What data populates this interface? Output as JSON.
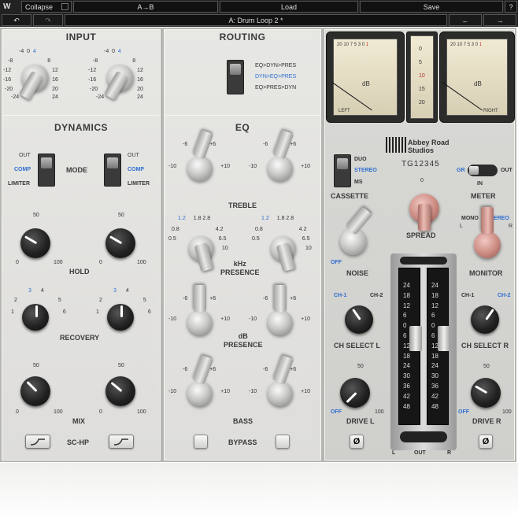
{
  "topbar": {
    "collapse": "Collapse",
    "ab": "A→B",
    "load": "Load",
    "save": "Save",
    "help": "?",
    "preset": "A: Drum Loop 2 *",
    "undo": "↶",
    "redo": "↷",
    "prev": "←",
    "next": "→"
  },
  "input": {
    "title": "INPUT",
    "scale": [
      "-4",
      "0",
      "4",
      "-8",
      "8",
      "-12",
      "12",
      "-16",
      "16",
      "-20",
      "20",
      "-24",
      "24"
    ]
  },
  "dynamics": {
    "title": "DYNAMICS",
    "mode": "MODE",
    "out": "OUT",
    "comp": "COMP",
    "limiter": "LIMITER",
    "hold": "HOLD",
    "recovery": "RECOVERY",
    "mix": "MIX",
    "schp": "SC-HP",
    "hold_scale": [
      "50",
      "0",
      "100"
    ],
    "rec_scale": [
      "1",
      "2",
      "3",
      "4",
      "5",
      "6"
    ],
    "mix_scale": [
      "50",
      "0",
      "100"
    ]
  },
  "routing": {
    "title": "ROUTING",
    "options": [
      "EQ>DYN>PRES",
      "DYN>EQ>PRES",
      "EQ>PRES>DYN"
    ],
    "selected": 1
  },
  "eq": {
    "title": "EQ",
    "treble": "TREBLE",
    "presence_freq": "kHz\nPRESENCE",
    "presence_gain": "dB\nPRESENCE",
    "bass": "BASS",
    "bypass": "BYPASS",
    "gain_scale": [
      "-6",
      "0",
      "+6",
      "-10",
      "+10"
    ],
    "freq_scale": [
      "1.2",
      "1.8",
      "2.8",
      "0.8",
      "4.2",
      "0.5",
      "6.5",
      "10"
    ]
  },
  "right": {
    "brand": "Abbey Road Studios",
    "model": "TG12345",
    "duo": "DUO",
    "stereo": "STEREO",
    "ms": "MS",
    "cassette": "CASSETTE",
    "gr": "GR",
    "in": "IN",
    "meter_out": "OUT",
    "meter": "METER",
    "spread": "SPREAD",
    "noise": "NOISE",
    "off": "OFF",
    "mono": "MONO",
    "stereo2": "STEREO",
    "l": "L",
    "r": "R",
    "monitor": "MONITOR",
    "ch1": "CH-1",
    "ch2": "CH-2",
    "chsel_l": "CH SELECT L",
    "chsel_r": "CH SELECT R",
    "drive_l": "DRIVE L",
    "drive_r": "DRIVE R",
    "out": "OUT",
    "out_l": "L",
    "out_r": "R",
    "phase": "Ø",
    "vu_left": "LEFT",
    "vu_right": "RIGHT",
    "vu_db": "dB",
    "meter_scale": [
      "24",
      "18",
      "12",
      "6",
      "0",
      "6",
      "12",
      "18",
      "24",
      "30",
      "36",
      "42",
      "48"
    ],
    "gr_scale": [
      "0",
      "5",
      "10",
      "15",
      "20"
    ],
    "vu_scale": [
      "20",
      "10",
      "7",
      "5",
      "3",
      "1",
      "0",
      "1",
      "2",
      "3"
    ]
  }
}
